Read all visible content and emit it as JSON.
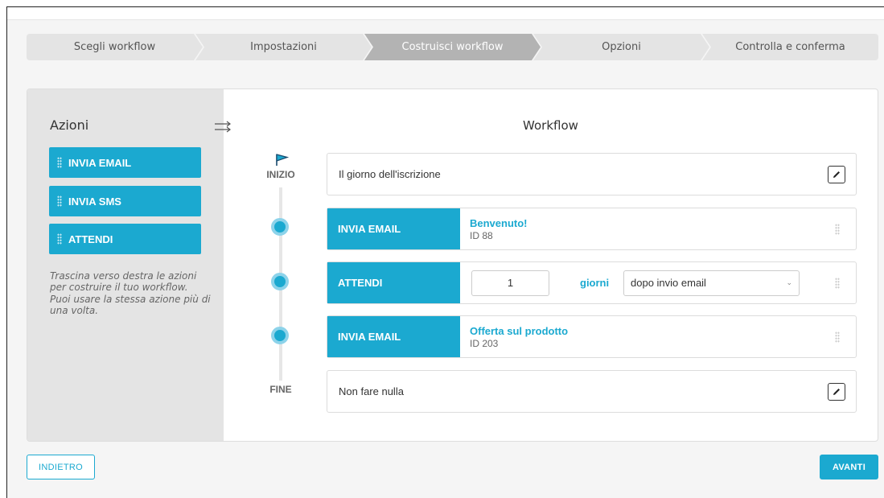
{
  "stepper": {
    "steps": [
      {
        "label": "Scegli workflow",
        "active": false
      },
      {
        "label": "Impostazioni",
        "active": false
      },
      {
        "label": "Costruisci workflow",
        "active": true
      },
      {
        "label": "Opzioni",
        "active": false
      },
      {
        "label": "Controlla e conferma",
        "active": false
      }
    ]
  },
  "sidebar": {
    "title": "Azioni",
    "actions": [
      "INVIA EMAIL",
      "INVIA SMS",
      "ATTENDI"
    ],
    "hint": "Trascina verso destra le azioni per costruire il tuo workflow. Puoi usare la stessa azione più di una volta."
  },
  "workflow": {
    "title": "Workflow",
    "start_label": "INIZIO",
    "end_label": "FINE",
    "start_row": "Il giorno dell'iscrizione",
    "end_row": "Non fare nulla",
    "steps": [
      {
        "type": "INVIA EMAIL",
        "title": "Benvenuto!",
        "sub": "ID 88"
      },
      {
        "type": "ATTENDI",
        "amount": "1",
        "unit": "giorni",
        "condition": "dopo invio email"
      },
      {
        "type": "INVIA EMAIL",
        "title": "Offerta sul prodotto",
        "sub": "ID 203"
      }
    ]
  },
  "footer": {
    "back_label": "INDIETRO",
    "next_label": "AVANTI"
  },
  "colors": {
    "accent": "#1ba9d0",
    "step_active": "#b3b3b3",
    "step_inactive": "#e4e4e4"
  },
  "icons": [
    "flag-icon",
    "swap-arrows-icon",
    "pencil-icon",
    "drag-handle-icon",
    "chevron-down-icon"
  ]
}
